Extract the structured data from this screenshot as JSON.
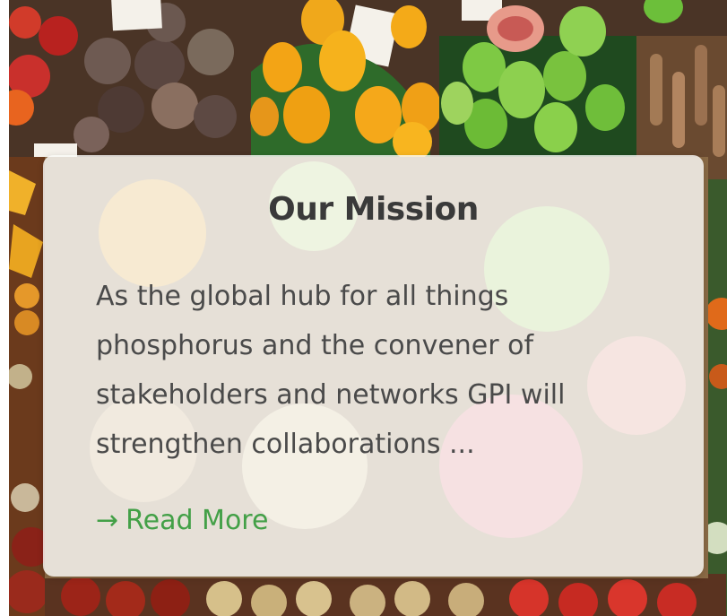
{
  "card": {
    "title": "Our Mission",
    "description": "As the global hub for all things phosphorus and the convener of stakeholders and networks GPI will strengthen collaborations ...",
    "link_arrow": "→",
    "link_label": "Read More"
  },
  "colors": {
    "link": "#43a047",
    "title": "#3a3a3a",
    "text": "#4a4a4a"
  }
}
